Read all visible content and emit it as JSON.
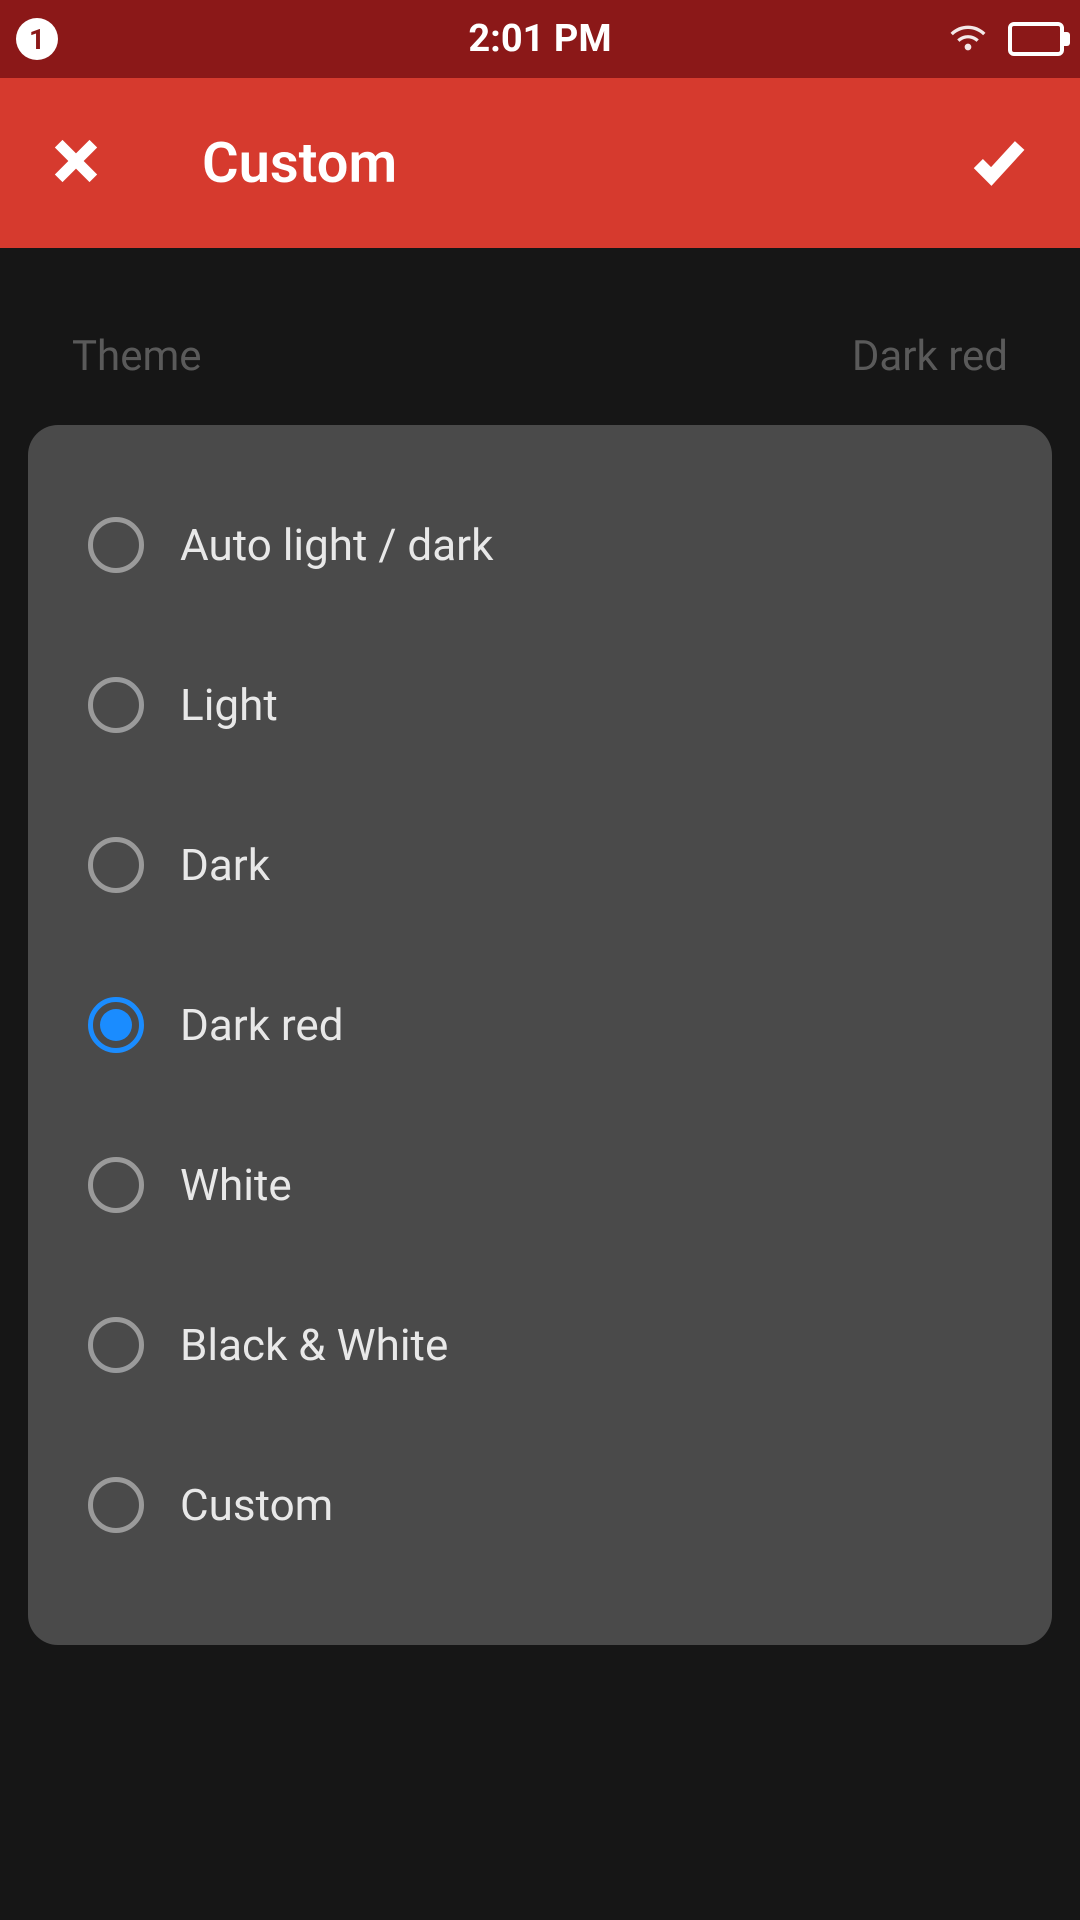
{
  "status_bar": {
    "notification_count": "1",
    "time": "2:01 PM"
  },
  "app_bar": {
    "title": "Custom"
  },
  "summary": {
    "label": "Theme",
    "value": "Dark red"
  },
  "theme_options": [
    {
      "label": "Auto light / dark",
      "selected": false
    },
    {
      "label": "Light",
      "selected": false
    },
    {
      "label": "Dark",
      "selected": false
    },
    {
      "label": "Dark red",
      "selected": true
    },
    {
      "label": "White",
      "selected": false
    },
    {
      "label": "Black & White",
      "selected": false
    },
    {
      "label": "Custom",
      "selected": false
    }
  ],
  "colors": {
    "status_bar_bg": "#8b1818",
    "app_bar_bg": "#d63a2e",
    "accent": "#1a8cff",
    "panel_bg": "#4a4a4a",
    "page_bg": "#161616"
  }
}
